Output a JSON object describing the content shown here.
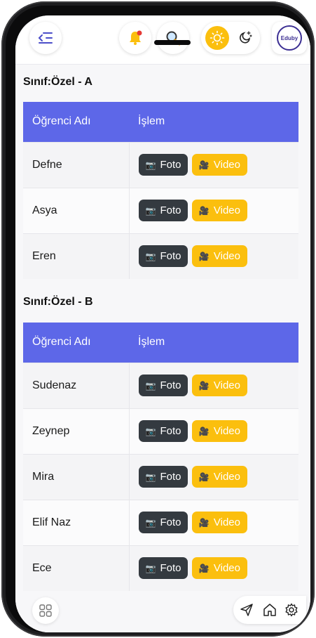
{
  "header": {
    "menu_icon": "menu-collapse-icon",
    "bell_icon": "bell-icon",
    "search_icon": "search-icon",
    "sun_icon": "sun-icon",
    "moon_icon": "moon-icon",
    "logo_text": "Eduby"
  },
  "colors": {
    "accent": "#5d67e8",
    "photo_button": "#343a40",
    "video_button": "#fbbf0e",
    "notification_dot": "#e53935"
  },
  "sections": [
    {
      "title": "Sınıf:Özel - A",
      "headers": [
        "Öğrenci Adı",
        "İşlem"
      ],
      "students": [
        "Defne",
        "Asya",
        "Eren"
      ]
    },
    {
      "title": "Sınıf:Özel - B",
      "headers": [
        "Öğrenci Adı",
        "İşlem"
      ],
      "students": [
        "Sudenaz",
        "Zeynep",
        "Mira",
        "Elif Naz",
        "Ece"
      ]
    }
  ],
  "buttons": {
    "photo_label": "Foto",
    "video_label": "Video",
    "photo_icon": "camera-icon",
    "video_icon": "video-camera-icon"
  },
  "bottom_nav": {
    "apps_icon": "apps-grid-icon",
    "send_icon": "send-icon",
    "home_icon": "home-icon",
    "settings_icon": "gear-icon"
  }
}
